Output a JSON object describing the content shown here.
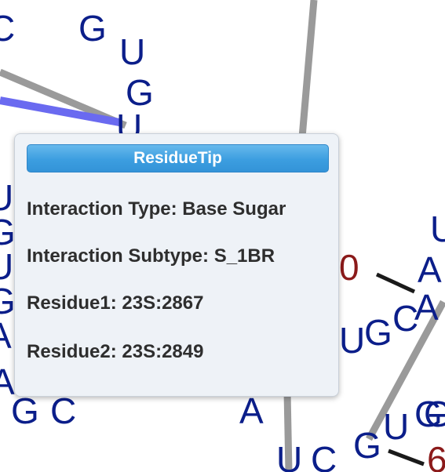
{
  "residue_tip": {
    "title": "ResidueTip",
    "lines": [
      "Interaction Type: Base Sugar",
      "Interaction Subtype: S_1BR",
      "Residue1: 23S:2867",
      "Residue2: 23S:2849"
    ]
  },
  "structure": {
    "nucleotide_letters": [
      "C",
      "G",
      "U",
      "G",
      "U",
      "U",
      "G",
      "U",
      "G",
      "A",
      "A",
      "G",
      "C",
      "U",
      "G",
      "C",
      "A",
      "A",
      "U",
      "C",
      "G",
      "U",
      "G",
      "U",
      "A",
      "G"
    ],
    "position_labels": [
      "0",
      "6"
    ]
  },
  "colors": {
    "nucleotide": "#0b1e8a",
    "position_number": "#8b1a1a",
    "highlight_link": "#6a6af0",
    "link": "#9a9a9a",
    "title_bar": "#3c9ee0"
  }
}
